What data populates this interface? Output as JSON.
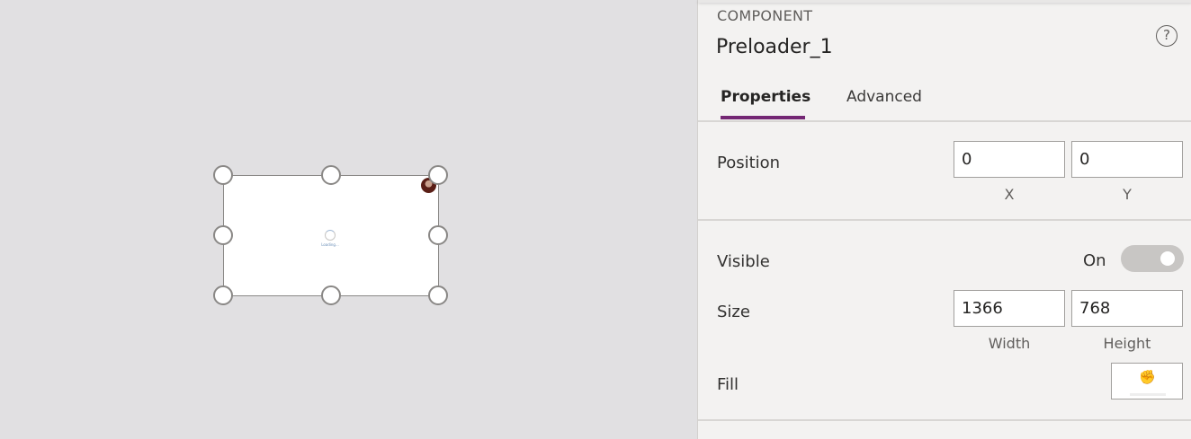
{
  "canvas": {
    "loading_text": "Loading..."
  },
  "panel": {
    "component_type": "COMPONENT",
    "component_name": "Preloader_1",
    "help_glyph": "?",
    "tabs": [
      {
        "label": "Properties",
        "active": true
      },
      {
        "label": "Advanced",
        "active": false
      }
    ],
    "position": {
      "label": "Position",
      "x_value": "0",
      "y_value": "0",
      "x_caption": "X",
      "y_caption": "Y"
    },
    "visible": {
      "label": "Visible",
      "state_text": "On",
      "on": true
    },
    "size": {
      "label": "Size",
      "width_value": "1366",
      "height_value": "768",
      "width_caption": "Width",
      "height_caption": "Height"
    },
    "fill": {
      "label": "Fill",
      "icon": "paint-bucket-icon",
      "color": "#ffffff"
    },
    "accent_color": "#742774"
  }
}
